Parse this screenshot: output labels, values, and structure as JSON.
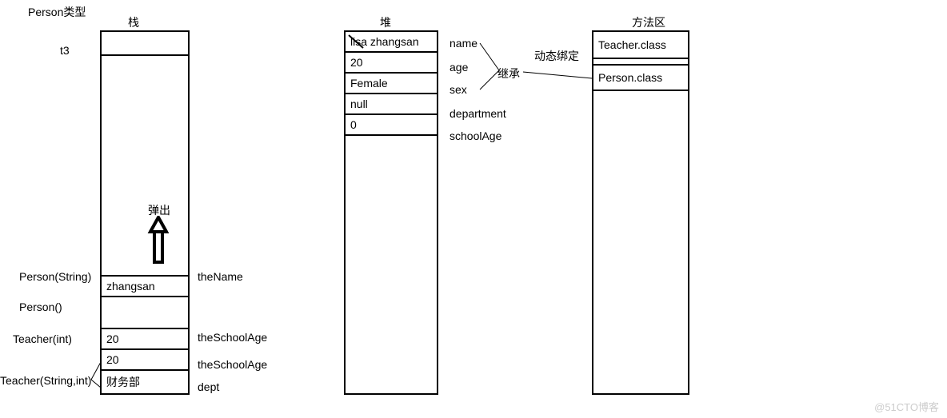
{
  "labels": {
    "person_type": "Person类型",
    "stack_title": "栈",
    "heap_title": "堆",
    "method_area_title": "方法区",
    "t3": "t3",
    "popup": "弹出",
    "inherit": "继承",
    "dynamic_bind": "动态绑定",
    "watermark": "@51CTO博客"
  },
  "stack": {
    "left_labels": {
      "person_string": "Person(String)",
      "person_empty": "Person()",
      "teacher_int": "Teacher(int)",
      "teacher_string_int": "Teacher(String,int)"
    },
    "cells": {
      "top_blank": "",
      "zhangsan": "zhangsan",
      "empty": "",
      "twenty1": "20",
      "twenty2": "20",
      "dept": "财务部"
    },
    "right_labels": {
      "theName": "theName",
      "theSchoolAge1": "theSchoolAge",
      "theSchoolAge2": "theSchoolAge",
      "dept": "dept"
    }
  },
  "heap": {
    "cells": {
      "name_val": "lisa zhangsan",
      "age_val": "20",
      "sex_val": "Female",
      "dept_val": "null",
      "schoolAge_val": "0"
    },
    "right_labels": {
      "name": "name",
      "age": "age",
      "sex": "sex",
      "department": "department",
      "schoolAge": "schoolAge"
    }
  },
  "method_area": {
    "teacher_class": "Teacher.class",
    "person_class": "Person.class"
  }
}
